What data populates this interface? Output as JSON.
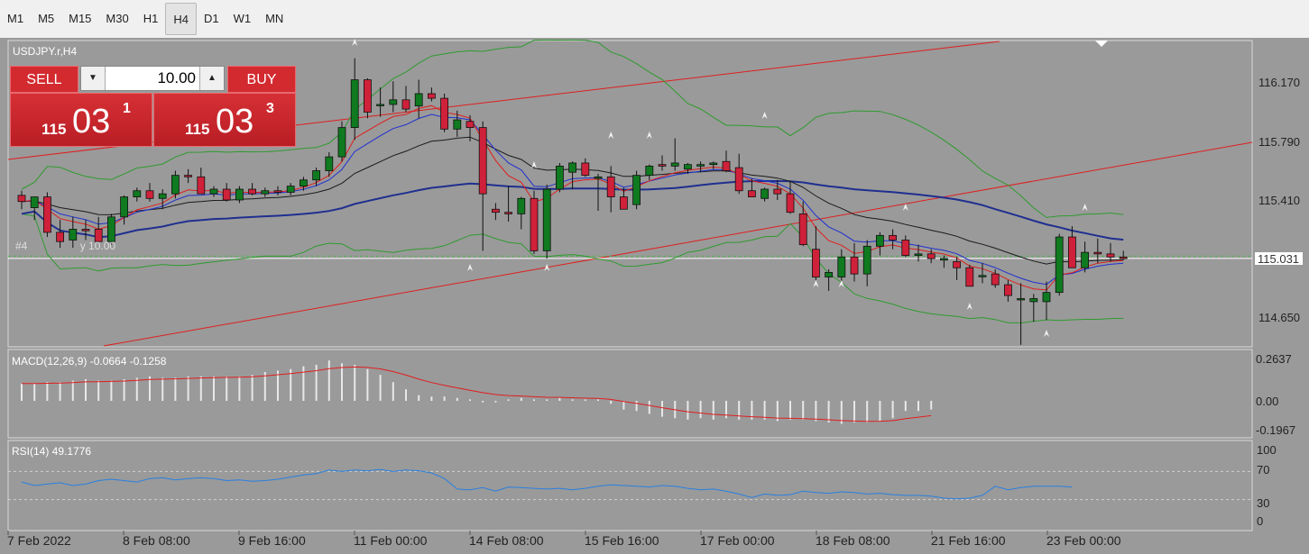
{
  "toolbar": {
    "timeframes": [
      {
        "label": "M1",
        "active": false
      },
      {
        "label": "M5",
        "active": false
      },
      {
        "label": "M15",
        "active": false
      },
      {
        "label": "M30",
        "active": false
      },
      {
        "label": "H1",
        "active": false
      },
      {
        "label": "H4",
        "active": true
      },
      {
        "label": "D1",
        "active": false
      },
      {
        "label": "W1",
        "active": false
      },
      {
        "label": "MN",
        "active": false
      }
    ]
  },
  "chart": {
    "symbol_label": "USDJPY.r,H4",
    "current_price": "115.031",
    "order_line_label": "#4",
    "order_line_label_tail": "y 10.00",
    "price_axis": [
      "116.170",
      "115.790",
      "115.410",
      "115.031",
      "114.650"
    ],
    "macd_label": "MACD(12,26,9) -0.0664 -0.1258",
    "macd_axis": [
      "0.2637",
      "0.00",
      "-0.1967"
    ],
    "rsi_label": "RSI(14) 49.1776",
    "rsi_axis": [
      "100",
      "70",
      "30",
      "0"
    ],
    "time_axis": [
      "7 Feb 2022",
      "8 Feb 08:00",
      "9 Feb 16:00",
      "11 Feb 00:00",
      "14 Feb 08:00",
      "15 Feb 16:00",
      "17 Feb 00:00",
      "18 Feb 08:00",
      "21 Feb 16:00",
      "23 Feb 00:00"
    ],
    "colors": {
      "background": "#9a9a9a",
      "bull": "#0f7a1f",
      "bear": "#d0213a",
      "ma_blue": "#1f2f8f",
      "ma_black": "#1a1a1a",
      "ma_red": "#e01e1e",
      "bollinger": "#2f9a2f",
      "rsi_line": "#2a7fe0",
      "macd_signal": "#e01e1e"
    }
  },
  "trade_panel": {
    "sell_label": "SELL",
    "buy_label": "BUY",
    "volume": "10.00",
    "sell_price": {
      "prefix": "115",
      "main": "03",
      "suffix": "1"
    },
    "buy_price": {
      "prefix": "115",
      "main": "03",
      "suffix": "3"
    }
  },
  "chart_data": {
    "type": "candlestick",
    "title": "USDJPY.r,H4",
    "ylim": [
      114.45,
      116.39
    ],
    "candles": [
      {
        "o": 115.44,
        "h": 115.47,
        "l": 115.35,
        "c": 115.4
      },
      {
        "o": 115.36,
        "h": 115.42,
        "l": 115.28,
        "c": 115.43
      },
      {
        "o": 115.43,
        "h": 115.46,
        "l": 115.17,
        "c": 115.2
      },
      {
        "o": 115.2,
        "h": 115.28,
        "l": 115.1,
        "c": 115.14
      },
      {
        "o": 115.15,
        "h": 115.3,
        "l": 115.1,
        "c": 115.22
      },
      {
        "o": 115.22,
        "h": 115.28,
        "l": 115.15,
        "c": 115.21
      },
      {
        "o": 115.22,
        "h": 115.3,
        "l": 115.18,
        "c": 115.14
      },
      {
        "o": 115.14,
        "h": 115.32,
        "l": 115.12,
        "c": 115.3
      },
      {
        "o": 115.3,
        "h": 115.44,
        "l": 115.25,
        "c": 115.43
      },
      {
        "o": 115.43,
        "h": 115.49,
        "l": 115.4,
        "c": 115.47
      },
      {
        "o": 115.47,
        "h": 115.52,
        "l": 115.4,
        "c": 115.42
      },
      {
        "o": 115.42,
        "h": 115.48,
        "l": 115.35,
        "c": 115.45
      },
      {
        "o": 115.45,
        "h": 115.6,
        "l": 115.42,
        "c": 115.57
      },
      {
        "o": 115.57,
        "h": 115.61,
        "l": 115.52,
        "c": 115.56
      },
      {
        "o": 115.56,
        "h": 115.62,
        "l": 115.45,
        "c": 115.45
      },
      {
        "o": 115.45,
        "h": 115.5,
        "l": 115.43,
        "c": 115.48
      },
      {
        "o": 115.48,
        "h": 115.52,
        "l": 115.4,
        "c": 115.41
      },
      {
        "o": 115.41,
        "h": 115.5,
        "l": 115.39,
        "c": 115.48
      },
      {
        "o": 115.48,
        "h": 115.52,
        "l": 115.44,
        "c": 115.45
      },
      {
        "o": 115.45,
        "h": 115.49,
        "l": 115.43,
        "c": 115.47
      },
      {
        "o": 115.47,
        "h": 115.5,
        "l": 115.44,
        "c": 115.46
      },
      {
        "o": 115.46,
        "h": 115.52,
        "l": 115.44,
        "c": 115.5
      },
      {
        "o": 115.5,
        "h": 115.56,
        "l": 115.47,
        "c": 115.54
      },
      {
        "o": 115.54,
        "h": 115.62,
        "l": 115.5,
        "c": 115.6
      },
      {
        "o": 115.6,
        "h": 115.72,
        "l": 115.56,
        "c": 115.69
      },
      {
        "o": 115.69,
        "h": 115.92,
        "l": 115.66,
        "c": 115.88
      },
      {
        "o": 115.88,
        "h": 116.33,
        "l": 115.8,
        "c": 116.19
      },
      {
        "o": 116.19,
        "h": 116.2,
        "l": 115.94,
        "c": 115.98
      },
      {
        "o": 116.03,
        "h": 116.14,
        "l": 115.95,
        "c": 116.03
      },
      {
        "o": 116.03,
        "h": 116.18,
        "l": 115.98,
        "c": 116.06
      },
      {
        "o": 116.06,
        "h": 116.15,
        "l": 115.98,
        "c": 116.0
      },
      {
        "o": 116.02,
        "h": 116.19,
        "l": 115.94,
        "c": 116.1
      },
      {
        "o": 116.1,
        "h": 116.14,
        "l": 116.05,
        "c": 116.07
      },
      {
        "o": 116.07,
        "h": 116.1,
        "l": 115.85,
        "c": 115.87
      },
      {
        "o": 115.87,
        "h": 115.99,
        "l": 115.82,
        "c": 115.93
      },
      {
        "o": 115.92,
        "h": 115.96,
        "l": 115.79,
        "c": 115.88
      },
      {
        "o": 115.88,
        "h": 115.92,
        "l": 115.08,
        "c": 115.45
      },
      {
        "o": 115.35,
        "h": 115.39,
        "l": 115.28,
        "c": 115.33
      },
      {
        "o": 115.33,
        "h": 115.5,
        "l": 115.27,
        "c": 115.32
      },
      {
        "o": 115.32,
        "h": 115.43,
        "l": 115.22,
        "c": 115.42
      },
      {
        "o": 115.42,
        "h": 115.47,
        "l": 115.06,
        "c": 115.08
      },
      {
        "o": 115.08,
        "h": 115.51,
        "l": 115.03,
        "c": 115.48
      },
      {
        "o": 115.48,
        "h": 115.65,
        "l": 115.46,
        "c": 115.63
      },
      {
        "o": 115.59,
        "h": 115.66,
        "l": 115.48,
        "c": 115.65
      },
      {
        "o": 115.65,
        "h": 115.68,
        "l": 115.56,
        "c": 115.57
      },
      {
        "o": 115.55,
        "h": 115.58,
        "l": 115.34,
        "c": 115.56
      },
      {
        "o": 115.56,
        "h": 115.63,
        "l": 115.33,
        "c": 115.43
      },
      {
        "o": 115.43,
        "h": 115.49,
        "l": 115.35,
        "c": 115.35
      },
      {
        "o": 115.38,
        "h": 115.6,
        "l": 115.35,
        "c": 115.57
      },
      {
        "o": 115.57,
        "h": 115.64,
        "l": 115.54,
        "c": 115.63
      },
      {
        "o": 115.64,
        "h": 115.7,
        "l": 115.6,
        "c": 115.63
      },
      {
        "o": 115.63,
        "h": 115.81,
        "l": 115.6,
        "c": 115.65
      },
      {
        "o": 115.61,
        "h": 115.65,
        "l": 115.58,
        "c": 115.64
      },
      {
        "o": 115.63,
        "h": 115.66,
        "l": 115.59,
        "c": 115.64
      },
      {
        "o": 115.64,
        "h": 115.66,
        "l": 115.61,
        "c": 115.65
      },
      {
        "o": 115.66,
        "h": 115.73,
        "l": 115.59,
        "c": 115.6
      },
      {
        "o": 115.62,
        "h": 115.71,
        "l": 115.45,
        "c": 115.47
      },
      {
        "o": 115.47,
        "h": 115.55,
        "l": 115.43,
        "c": 115.43
      },
      {
        "o": 115.42,
        "h": 115.49,
        "l": 115.4,
        "c": 115.48
      },
      {
        "o": 115.48,
        "h": 115.54,
        "l": 115.41,
        "c": 115.45
      },
      {
        "o": 115.45,
        "h": 115.53,
        "l": 115.32,
        "c": 115.33
      },
      {
        "o": 115.32,
        "h": 115.4,
        "l": 115.11,
        "c": 115.12
      },
      {
        "o": 115.09,
        "h": 115.24,
        "l": 114.89,
        "c": 114.91
      },
      {
        "o": 114.91,
        "h": 114.96,
        "l": 114.82,
        "c": 114.94
      },
      {
        "o": 114.91,
        "h": 115.09,
        "l": 114.87,
        "c": 115.04
      },
      {
        "o": 115.04,
        "h": 115.13,
        "l": 114.88,
        "c": 114.93
      },
      {
        "o": 114.93,
        "h": 115.15,
        "l": 114.85,
        "c": 115.11
      },
      {
        "o": 115.11,
        "h": 115.2,
        "l": 115.05,
        "c": 115.18
      },
      {
        "o": 115.18,
        "h": 115.22,
        "l": 115.09,
        "c": 115.15
      },
      {
        "o": 115.15,
        "h": 115.18,
        "l": 115.04,
        "c": 115.05
      },
      {
        "o": 115.05,
        "h": 115.12,
        "l": 115.01,
        "c": 115.06
      },
      {
        "o": 115.06,
        "h": 115.09,
        "l": 115.0,
        "c": 115.03
      },
      {
        "o": 115.02,
        "h": 115.05,
        "l": 114.97,
        "c": 115.03
      },
      {
        "o": 115.01,
        "h": 115.04,
        "l": 114.89,
        "c": 114.97
      },
      {
        "o": 114.97,
        "h": 114.99,
        "l": 114.88,
        "c": 114.85
      },
      {
        "o": 114.92,
        "h": 115.0,
        "l": 114.87,
        "c": 114.92
      },
      {
        "o": 114.93,
        "h": 114.96,
        "l": 114.84,
        "c": 114.86
      },
      {
        "o": 114.86,
        "h": 114.89,
        "l": 114.75,
        "c": 114.79
      },
      {
        "o": 114.77,
        "h": 114.87,
        "l": 114.47,
        "c": 114.77
      },
      {
        "o": 114.75,
        "h": 114.8,
        "l": 114.62,
        "c": 114.77
      },
      {
        "o": 114.75,
        "h": 114.88,
        "l": 114.63,
        "c": 114.81
      },
      {
        "o": 114.81,
        "h": 115.19,
        "l": 114.79,
        "c": 115.17
      },
      {
        "o": 115.17,
        "h": 115.24,
        "l": 114.97,
        "c": 114.97
      },
      {
        "o": 114.97,
        "h": 115.14,
        "l": 114.94,
        "c": 115.07
      },
      {
        "o": 115.07,
        "h": 115.16,
        "l": 115.0,
        "c": 115.06
      },
      {
        "o": 115.06,
        "h": 115.13,
        "l": 115.01,
        "c": 115.04
      },
      {
        "o": 115.04,
        "h": 115.08,
        "l": 115.02,
        "c": 115.03
      }
    ],
    "macd_hist": [
      0.12,
      0.12,
      0.13,
      0.13,
      0.14,
      0.15,
      0.14,
      0.14,
      0.15,
      0.16,
      0.17,
      0.16,
      0.16,
      0.17,
      0.17,
      0.17,
      0.17,
      0.17,
      0.18,
      0.2,
      0.21,
      0.22,
      0.24,
      0.25,
      0.28,
      0.26,
      0.25,
      0.22,
      0.18,
      0.13,
      0.08,
      0.04,
      0.03,
      0.03,
      0.02,
      0.01,
      -0.01,
      -0.01,
      0.01,
      0.02,
      0.01,
      0.01,
      0.02,
      0.01,
      0.01,
      0.01,
      -0.02,
      -0.06,
      -0.07,
      -0.09,
      -0.11,
      -0.12,
      -0.13,
      -0.12,
      -0.13,
      -0.12,
      -0.13,
      -0.13,
      -0.13,
      -0.14,
      -0.13,
      -0.13,
      -0.14,
      -0.15,
      -0.16,
      -0.15,
      -0.15,
      -0.14,
      -0.12,
      -0.07,
      -0.07,
      -0.06
    ],
    "rsi": [
      55,
      50,
      52,
      54,
      50,
      52,
      57,
      59,
      57,
      55,
      60,
      61,
      58,
      60,
      61,
      60,
      57,
      58,
      56,
      57,
      59,
      62,
      65,
      67,
      72,
      70,
      72,
      71,
      73,
      70,
      72,
      71,
      68,
      60,
      45,
      44,
      47,
      42,
      48,
      47,
      46,
      45,
      46,
      44,
      46,
      49,
      51,
      50,
      49,
      48,
      50,
      49,
      46,
      44,
      45,
      42,
      38,
      33,
      38,
      36,
      37,
      42,
      40,
      39,
      41,
      40,
      38,
      39,
      37,
      36,
      36,
      35,
      32,
      31,
      32,
      36,
      49,
      44,
      47,
      49,
      49,
      49,
      48
    ],
    "price_axis_ticks": [
      116.17,
      115.79,
      115.41,
      115.031,
      114.65
    ],
    "macd_axis_ticks": [
      0.2637,
      0.0,
      -0.1967
    ],
    "rsi_levels": [
      30,
      70
    ]
  }
}
